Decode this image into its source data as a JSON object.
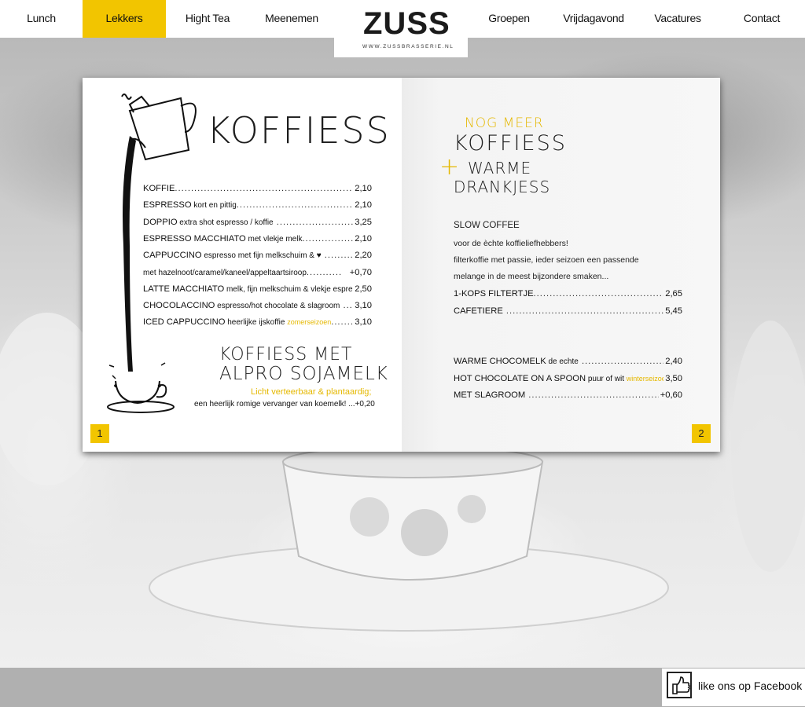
{
  "nav": {
    "left": [
      "Lunch",
      "Lekkers",
      "Hight Tea",
      "Meenemen"
    ],
    "right": [
      "Groepen",
      "Vrijdagavond",
      "Vacatures",
      "Contact"
    ],
    "active": "Lekkers"
  },
  "logo": {
    "text": "ZUSS",
    "url": "WWW.ZUSSBRASSERIE.NL"
  },
  "left_page": {
    "title": "KOFFIESS",
    "number": "1",
    "items": [
      {
        "name": "KOFFIE",
        "desc": "",
        "highlight": "",
        "dots": "..................................................................",
        "price": "2,10"
      },
      {
        "name": "ESPRESSO",
        "desc": " kort en pittig",
        "highlight": "",
        "dots": ".........................................",
        "price": "2,10"
      },
      {
        "name": "DOPPIO",
        "desc": " extra shot espresso / koffie",
        "highlight": "",
        "dots": " ............................",
        "price": "3,25"
      },
      {
        "name": "ESPRESSO MACCHIATO",
        "desc": " met vlekje melk",
        "highlight": "",
        "dots": "...................",
        "price": "2,10"
      },
      {
        "name": "CAPPUCCINO",
        "desc": " espresso met fijn melkschuim & ♥",
        "highlight": "",
        "dots": " .........",
        "price": "2,20"
      },
      {
        "name": "",
        "desc": "met hazelnoot/caramel/kaneel/appeltaartsiroop",
        "highlight": "",
        "dots": "...........",
        "price": "+0,70"
      },
      {
        "name": "LATTE MACCHIATO",
        "desc": " melk, fijn melkschuim & vlekje espresso",
        "highlight": "",
        "dots": "...",
        "price": "2,50"
      },
      {
        "name": "CHOCOLACCINO",
        "desc": " espresso/hot chocolate & slagroom",
        "highlight": "",
        "dots": " ...",
        "price": "3,10"
      },
      {
        "name": "ICED CAPPUCCINO",
        "desc": " heerlijke ijskoffie ",
        "highlight": "zomerseizoen",
        "dots": "........",
        "price": "3,10"
      }
    ],
    "soja_title_1": "KOFFIESS MET",
    "soja_title_2": "ALPRO SOJAMELK",
    "soja_subtitle": "Licht verteerbaar & plantaardig;",
    "soja_line": "een heerlijk romige vervanger van koemelk! ...+0,20"
  },
  "right_page": {
    "number": "2",
    "heading_1": "NOG MEER",
    "heading_2": "KOFFIESS",
    "heading_3": "WARME",
    "heading_4": "DRANKJESS",
    "slow_title": "SLOW COFFEE",
    "slow_lines": [
      "voor de èchte koffieliefhebbers!",
      "filterkoffie met passie, ieder seizoen een passende",
      "melange in de meest bijzondere smaken..."
    ],
    "items_a": [
      {
        "name": "1-KOPS FILTERTJE",
        "desc": "",
        "highlight": "",
        "dots": ".....................................................",
        "price": "2,65"
      },
      {
        "name": "CAFETIERE",
        "desc": "",
        "highlight": "",
        "dots": " ...........................................................",
        "price": "5,45"
      }
    ],
    "items_b": [
      {
        "name": "WARME CHOCOMELK",
        "desc": " de echte",
        "highlight": "",
        "dots": " ...................................",
        "price": "2,40"
      },
      {
        "name": "HOT CHOCOLATE ON A SPOON",
        "desc": " puur of wit ",
        "highlight": "winterseizoen",
        "dots": "...",
        "price": "3,50"
      },
      {
        "name": "MET SLAGROOM",
        "desc": "",
        "highlight": "",
        "dots": " .................................................",
        "price": "+0,60"
      }
    ]
  },
  "footer": {
    "facebook": "like ons op Facebook"
  },
  "colors": {
    "accent": "#f2c500",
    "footer": "#b0b0b0"
  }
}
